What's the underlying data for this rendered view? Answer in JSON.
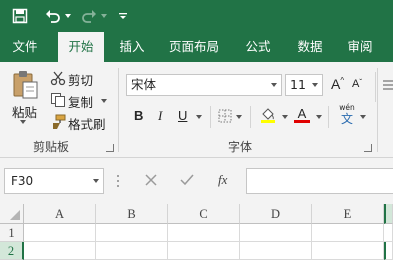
{
  "quick_access": {
    "save_icon": "save-icon",
    "undo_icon": "undo-icon",
    "redo_icon": "redo-icon",
    "customize_icon": "customize-qat-icon"
  },
  "tabs": [
    {
      "label": "文件"
    },
    {
      "label": "开始"
    },
    {
      "label": "插入"
    },
    {
      "label": "页面布局"
    },
    {
      "label": "公式"
    },
    {
      "label": "数据"
    },
    {
      "label": "审阅"
    }
  ],
  "ribbon": {
    "clipboard": {
      "paste_label": "粘贴",
      "cut_label": "剪切",
      "copy_label": "复制",
      "format_painter_label": "格式刷",
      "group_label": "剪贴板"
    },
    "font": {
      "font_name": "宋体",
      "font_size": "11",
      "bold": "B",
      "italic": "I",
      "underline": "U",
      "grow": "A",
      "shrink": "A",
      "font_color_letter": "A",
      "phonetic": "wén",
      "phonetic_char": "文",
      "group_label": "字体"
    }
  },
  "formula_bar": {
    "name_box": "F30",
    "fx_label": "fx",
    "value": ""
  },
  "grid": {
    "columns": [
      "A",
      "B",
      "C",
      "D",
      "E"
    ],
    "rows": [
      "1",
      "2"
    ]
  },
  "colors": {
    "brand": "#217346",
    "highlight_yellow": "#ffff00",
    "font_red": "#e00000"
  }
}
